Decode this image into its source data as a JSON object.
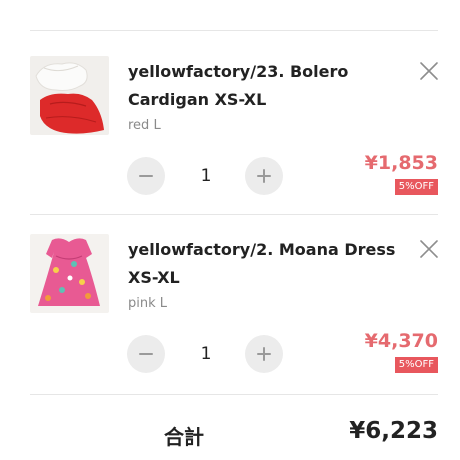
{
  "cart": {
    "items": [
      {
        "title": "yellowfactory/23. Bolero Cardigan XS-XL",
        "variant": "red L",
        "quantity": "1",
        "price": "¥1,853",
        "discount_badge": "5%OFF",
        "image": "bolero-cardigan-photo"
      },
      {
        "title": "yellowfactory/2. Moana Dress XS-XL",
        "variant": "pink L",
        "quantity": "1",
        "price": "¥4,370",
        "discount_badge": "5%OFF",
        "image": "moana-dress-photo"
      }
    ],
    "total_label": "合計",
    "total_value": "¥6,223"
  },
  "icons": {
    "remove": "close-icon",
    "decrease": "minus-icon",
    "increase": "plus-icon"
  },
  "colors": {
    "price": "#e56a6f",
    "badge": "#e8575d",
    "divider": "#e6e6e6",
    "qty_button": "#ececec"
  }
}
